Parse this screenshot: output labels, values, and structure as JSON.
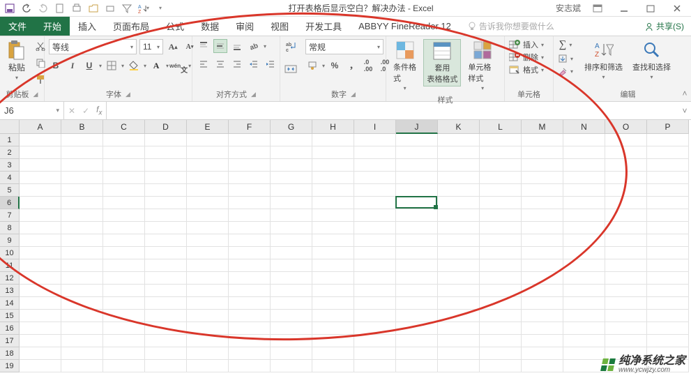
{
  "title_bar": {
    "doc_title": "打开表格后显示空白？解决办法  -  Excel",
    "user_name": "安志斌"
  },
  "tabs": {
    "file": "文件",
    "items": [
      "开始",
      "插入",
      "页面布局",
      "公式",
      "数据",
      "审阅",
      "视图",
      "开发工具",
      "ABBYY FineReader 12"
    ],
    "active_index": 0,
    "tell_me_placeholder": "告诉我你想要做什么",
    "share": "共享(S)"
  },
  "ribbon": {
    "clipboard": {
      "paste": "粘贴",
      "label": "剪贴板"
    },
    "font": {
      "family": "等线",
      "size": "11",
      "label": "字体"
    },
    "alignment": {
      "wrap": "自动换行",
      "merge": "合并后居中",
      "label": "对齐方式"
    },
    "number": {
      "format": "常规",
      "label": "数字"
    },
    "styles": {
      "cond": "条件格式",
      "astable": "套用\n表格格式",
      "cellstyle": "单元格样式",
      "label": "样式"
    },
    "cells": {
      "insert": "插入",
      "delete": "删除",
      "format": "格式",
      "label": "单元格"
    },
    "editing": {
      "sort": "排序和筛选",
      "find": "查找和选择",
      "label": "编辑"
    }
  },
  "formula_bar": {
    "name_box": "J6",
    "formula": ""
  },
  "grid": {
    "columns": [
      "A",
      "B",
      "C",
      "D",
      "E",
      "F",
      "G",
      "H",
      "I",
      "J",
      "K",
      "L",
      "M",
      "N",
      "O",
      "P"
    ],
    "rows": [
      1,
      2,
      3,
      4,
      5,
      6,
      7,
      8,
      9,
      10,
      11,
      12,
      13,
      14,
      15,
      16,
      17,
      18,
      19
    ],
    "selected_col": "J",
    "selected_row": 6
  },
  "watermark": {
    "title": "纯净系统之家",
    "url": "www.ycwjzy.com"
  }
}
